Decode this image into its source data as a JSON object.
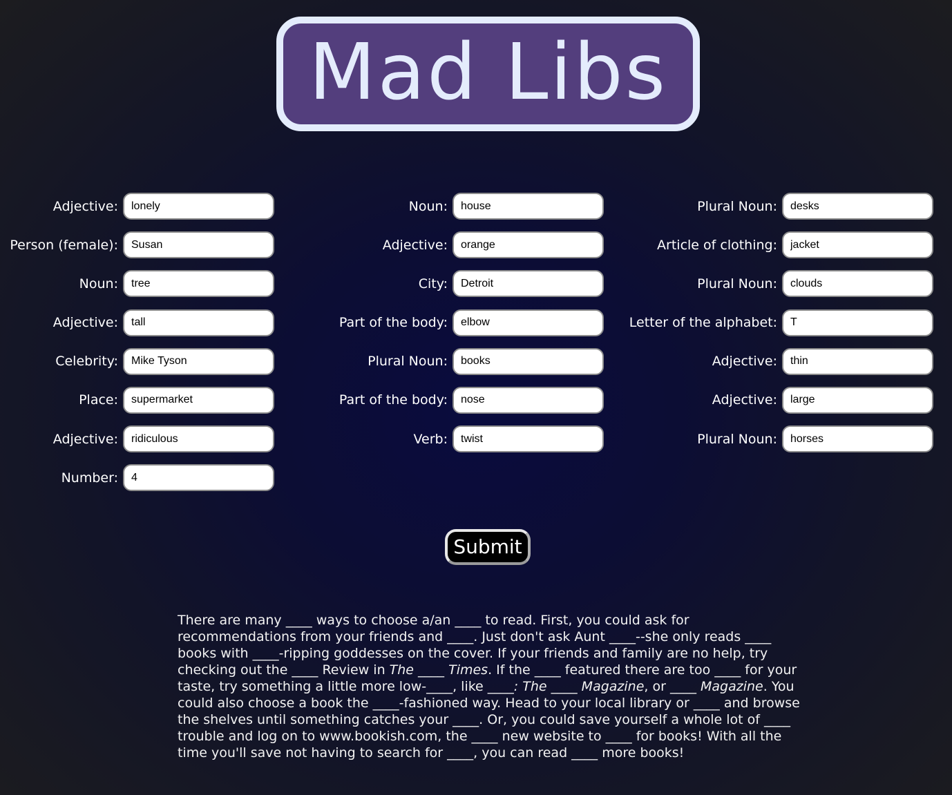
{
  "title": "Mad Libs",
  "columns": [
    [
      {
        "label": "Adjective:",
        "value": "lonely"
      },
      {
        "label": "Person (female):",
        "value": "Susan"
      },
      {
        "label": "Noun:",
        "value": "tree"
      },
      {
        "label": "Adjective:",
        "value": "tall"
      },
      {
        "label": "Celebrity:",
        "value": "Mike Tyson"
      },
      {
        "label": "Place:",
        "value": "supermarket"
      },
      {
        "label": "Adjective:",
        "value": "ridiculous"
      },
      {
        "label": "Number:",
        "value": "4"
      }
    ],
    [
      {
        "label": "Noun:",
        "value": "house"
      },
      {
        "label": "Adjective:",
        "value": "orange"
      },
      {
        "label": "City:",
        "value": "Detroit"
      },
      {
        "label": "Part of the body:",
        "value": "elbow"
      },
      {
        "label": "Plural Noun:",
        "value": "books"
      },
      {
        "label": "Part of the body:",
        "value": "nose"
      },
      {
        "label": "Verb:",
        "value": "twist"
      }
    ],
    [
      {
        "label": "Plural Noun:",
        "value": "desks"
      },
      {
        "label": "Article of clothing:",
        "value": "jacket"
      },
      {
        "label": "Plural Noun:",
        "value": "clouds"
      },
      {
        "label": "Letter of the alphabet:",
        "value": "T"
      },
      {
        "label": "Adjective:",
        "value": "thin"
      },
      {
        "label": "Adjective:",
        "value": "large"
      },
      {
        "label": "Plural Noun:",
        "value": "horses"
      }
    ]
  ],
  "submit_label": "Submit",
  "story": {
    "s1": "There are many ____ ways to choose a/an ____ to read. First, you could ask for recommendations from your friends and ____. Just don't ask Aunt ____--she only reads ____ books with ____-ripping goddesses on the cover. If your friends and family are no help, try checking out the ____ Review in ",
    "i1": "The",
    "s2": " ____ ",
    "i2": "Times",
    "s3": ". If the ____ featured there are too ____ for your taste, try something a little more low-____, like ____",
    "i3": ": The",
    "s4": " ____ ",
    "i4": "Magazine",
    "s5": ", or ____ ",
    "i5": "Magazine",
    "s6": ". You could also choose a book the ____-fashioned way. Head to your local library or ____ and browse the shelves until something catches your ____. Or, you could save yourself a whole lot of ____ trouble and log on to www.bookish.com, the ____ new website to ____ for books! With all the time you'll save not having to search for ____, you can read ____ more books!"
  },
  "colors": {
    "title_fill": "#533e7d",
    "title_border": "#e4ecfc",
    "button_bg": "#000000"
  }
}
